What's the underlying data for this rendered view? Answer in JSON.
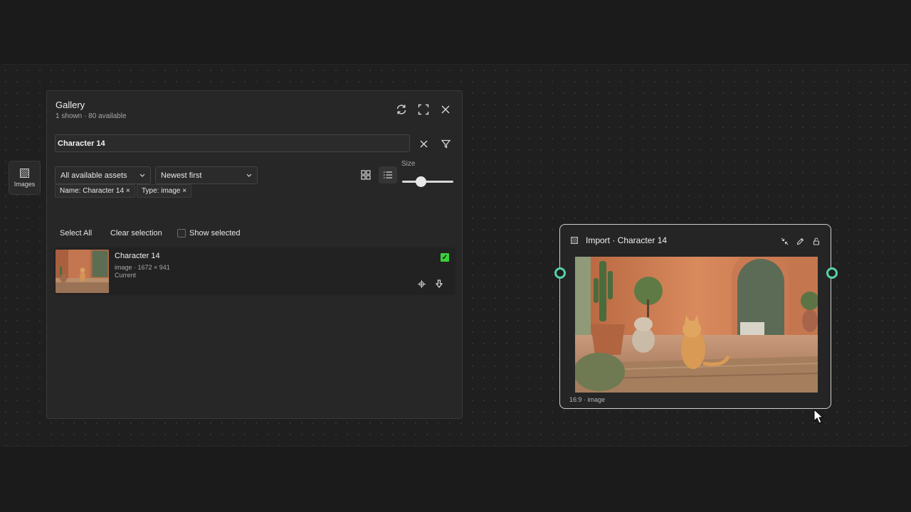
{
  "rail": {
    "images_label": "Images",
    "icon": "images-icon"
  },
  "gallery": {
    "title": "Gallery",
    "subtitle": "1 shown · 80 available",
    "header_icons": [
      "refresh-icon",
      "expand-icon",
      "close-icon"
    ],
    "search": {
      "value": "Character 14"
    },
    "filters": {
      "source": "All available assets",
      "sort": "Newest first"
    },
    "size_label": "Size",
    "size_value": 0.35,
    "chips": [
      "Name: Character 14 ×",
      "Type: image ×"
    ],
    "actions": {
      "select_all": "Select All",
      "clear_selection": "Clear selection",
      "show_selected": "Show selected"
    },
    "items": [
      {
        "name": "Character 14",
        "meta": "image · 1672 × 941",
        "status": "Current",
        "selected": true
      }
    ]
  },
  "node": {
    "title": "Import · Character 14",
    "footer": "16:9 · image",
    "tools": [
      "collapse-icon",
      "edit-icon",
      "lock-icon"
    ]
  },
  "colors": {
    "port": "#57d1a6",
    "check": "#3ad13a",
    "bg": "#1b1b1b"
  }
}
